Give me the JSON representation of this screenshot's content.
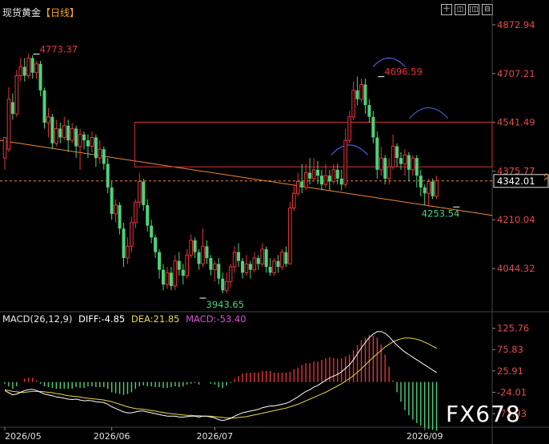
{
  "title": "现货黄金",
  "period_label": "【日线】",
  "toolbar": [
    "十",
    "◫",
    "|◫",
    "⊟"
  ],
  "watermark": "FX678",
  "colors": {
    "up": "#e8333a",
    "down": "#4fd17a",
    "diff": "#ffffff",
    "dea": "#e6d94a",
    "macd_label": "#d652d6",
    "trend": "#f0883a",
    "axis_label": "#e34a4a",
    "box": "#d8333a",
    "arc": "#4a5ad8",
    "current": "#f0883a"
  },
  "chart_data": [
    {
      "type": "candlestick",
      "y_axis_labels": [
        "4872.94",
        "4707.21",
        "4541.49",
        "4375.77",
        "4210.04",
        "4044.32"
      ],
      "ylim": [
        3900,
        4930
      ],
      "current_price": "4342.01",
      "x_axis_labels": [
        "2026/05",
        "2026/06",
        "2026/07",
        "2026/09"
      ],
      "annotations": [
        {
          "text": "4773.37",
          "price": 4773.37,
          "index": 8
        },
        {
          "text": "4696.59",
          "price": 4696.59,
          "index": 95
        },
        {
          "text": "4253.54",
          "price": 4253.54,
          "index": 114
        },
        {
          "text": "3943.65",
          "price": 3943.65,
          "index": 50
        }
      ],
      "candles": [
        [
          4420,
          4490,
          4455,
          4380
        ],
        [
          4450,
          4620,
          4660,
          4440
        ],
        [
          4610,
          4570,
          4640,
          4550
        ],
        [
          4570,
          4700,
          4720,
          4560
        ],
        [
          4700,
          4730,
          4760,
          4680
        ],
        [
          4730,
          4700,
          4760,
          4680
        ],
        [
          4700,
          4760,
          4773.37,
          4690
        ],
        [
          4760,
          4710,
          4770,
          4690
        ],
        [
          4710,
          4740,
          4750,
          4690
        ],
        [
          4740,
          4650,
          4750,
          4630
        ],
        [
          4650,
          4540,
          4660,
          4520
        ],
        [
          4540,
          4560,
          4590,
          4490
        ],
        [
          4560,
          4470,
          4570,
          4450
        ],
        [
          4470,
          4520,
          4550,
          4460
        ],
        [
          4520,
          4490,
          4540,
          4470
        ],
        [
          4490,
          4530,
          4560,
          4480
        ],
        [
          4530,
          4480,
          4550,
          4440
        ],
        [
          4480,
          4520,
          4540,
          4470
        ],
        [
          4520,
          4460,
          4530,
          4420
        ],
        [
          4460,
          4500,
          4520,
          4380
        ],
        [
          4500,
          4480,
          4510,
          4450
        ],
        [
          4480,
          4460,
          4500,
          4420
        ],
        [
          4460,
          4490,
          4510,
          4440
        ],
        [
          4490,
          4420,
          4500,
          4390
        ],
        [
          4420,
          4450,
          4480,
          4400
        ],
        [
          4450,
          4400,
          4460,
          4380
        ],
        [
          4400,
          4320,
          4420,
          4300
        ],
        [
          4320,
          4230,
          4340,
          4210
        ],
        [
          4230,
          4260,
          4280,
          4200
        ],
        [
          4260,
          4180,
          4270,
          4160
        ],
        [
          4180,
          4080,
          4200,
          4050
        ],
        [
          4080,
          4120,
          4150,
          4060
        ],
        [
          4120,
          4200,
          4220,
          4100
        ],
        [
          4200,
          4270,
          4280,
          4180
        ],
        [
          4270,
          4340,
          4370,
          4250
        ],
        [
          4340,
          4260,
          4350,
          4240
        ],
        [
          4260,
          4190,
          4280,
          4170
        ],
        [
          4190,
          4150,
          4210,
          4130
        ],
        [
          4150,
          4100,
          4160,
          4080
        ],
        [
          4100,
          4040,
          4110,
          4010
        ],
        [
          4040,
          3990,
          4060,
          3970
        ],
        [
          3990,
          4030,
          4050,
          3975
        ],
        [
          4030,
          3985,
          4050,
          3970
        ],
        [
          3985,
          4070,
          4090,
          3970
        ],
        [
          4070,
          4040,
          4100,
          4020
        ],
        [
          4040,
          4020,
          4060,
          3990
        ],
        [
          4020,
          4090,
          4110,
          4010
        ],
        [
          4090,
          4140,
          4160,
          4080
        ],
        [
          4140,
          4100,
          4150,
          4080
        ],
        [
          4100,
          4060,
          4110,
          4040
        ],
        [
          4060,
          4120,
          4180,
          4050
        ],
        [
          4120,
          4080,
          4140,
          4060
        ],
        [
          4080,
          4040,
          4090,
          4020
        ],
        [
          4040,
          4060,
          4070,
          4000
        ],
        [
          4060,
          4010,
          4080,
          3990
        ],
        [
          4010,
          3970,
          4030,
          3960
        ],
        [
          3970,
          4000,
          4030,
          3960
        ],
        [
          4000,
          4050,
          4060,
          3980
        ],
        [
          4050,
          4100,
          4120,
          4030
        ],
        [
          4100,
          4070,
          4130,
          4050
        ],
        [
          4070,
          4030,
          4080,
          4010
        ],
        [
          4030,
          4060,
          4090,
          4020
        ],
        [
          4060,
          4040,
          4070,
          4010
        ],
        [
          4040,
          4080,
          4100,
          4030
        ],
        [
          4080,
          4060,
          4090,
          4040
        ],
        [
          4060,
          4110,
          4130,
          4050
        ],
        [
          4110,
          4050,
          4120,
          4030
        ],
        [
          4050,
          4030,
          4080,
          4020
        ],
        [
          4030,
          4070,
          4080,
          4020
        ],
        [
          4070,
          4050,
          4090,
          4030
        ],
        [
          4050,
          4100,
          4110,
          4040
        ],
        [
          4100,
          4060,
          4120,
          4050
        ],
        [
          4060,
          4250,
          4270,
          4060
        ],
        [
          4250,
          4300,
          4330,
          4240
        ],
        [
          4300,
          4340,
          4370,
          4290
        ],
        [
          4340,
          4320,
          4400,
          4300
        ],
        [
          4320,
          4370,
          4400,
          4310
        ],
        [
          4370,
          4350,
          4420,
          4330
        ],
        [
          4350,
          4380,
          4420,
          4340
        ],
        [
          4380,
          4360,
          4410,
          4330
        ],
        [
          4360,
          4330,
          4380,
          4310
        ],
        [
          4330,
          4360,
          4400,
          4320
        ],
        [
          4360,
          4340,
          4380,
          4310
        ],
        [
          4340,
          4380,
          4400,
          4330
        ],
        [
          4380,
          4350,
          4400,
          4330
        ],
        [
          4350,
          4330,
          4380,
          4310
        ],
        [
          4330,
          4480,
          4520,
          4320
        ],
        [
          4480,
          4560,
          4580,
          4470
        ],
        [
          4560,
          4650,
          4680,
          4550
        ],
        [
          4650,
          4620,
          4696.59,
          4600
        ],
        [
          4620,
          4670,
          4690,
          4610
        ],
        [
          4670,
          4600,
          4690,
          4570
        ],
        [
          4600,
          4560,
          4620,
          4540
        ],
        [
          4560,
          4490,
          4580,
          4470
        ],
        [
          4490,
          4380,
          4510,
          4350
        ],
        [
          4380,
          4420,
          4460,
          4360
        ],
        [
          4420,
          4350,
          4430,
          4330
        ],
        [
          4350,
          4390,
          4420,
          4330
        ],
        [
          4390,
          4460,
          4500,
          4380
        ],
        [
          4460,
          4420,
          4470,
          4390
        ],
        [
          4420,
          4400,
          4440,
          4380
        ],
        [
          4400,
          4430,
          4450,
          4360
        ],
        [
          4430,
          4380,
          4440,
          4340
        ],
        [
          4380,
          4420,
          4430,
          4360
        ],
        [
          4420,
          4360,
          4430,
          4320
        ],
        [
          4360,
          4320,
          4380,
          4290
        ],
        [
          4320,
          4300,
          4330,
          4260
        ],
        [
          4300,
          4340,
          4350,
          4253.54
        ],
        [
          4340,
          4290,
          4350,
          4280
        ],
        [
          4290,
          4342,
          4360,
          4280
        ]
      ]
    },
    {
      "type": "macd",
      "legend": {
        "name": "MACD(26,12,9)",
        "diff": "DIFF:-4.85",
        "dea": "DEA:21.85",
        "macd": "MACD:-53.40"
      },
      "y_axis_labels": [
        "125.76",
        "75.83",
        "25.91",
        "-24.01",
        "-73.93"
      ],
      "ylim": [
        -100,
        140
      ],
      "diff": [
        -20,
        -25,
        -30,
        -28,
        -24,
        -20,
        -18,
        -17,
        -20,
        -24,
        -28,
        -30,
        -32,
        -35,
        -36,
        -38,
        -40,
        -41,
        -40,
        -42,
        -44,
        -43,
        -44,
        -46,
        -47,
        -48,
        -52,
        -58,
        -62,
        -66,
        -70,
        -72,
        -72,
        -70,
        -68,
        -68,
        -70,
        -72,
        -74,
        -76,
        -78,
        -80,
        -80,
        -80,
        -82,
        -82,
        -81,
        -80,
        -80,
        -82,
        -80,
        -80,
        -82,
        -84,
        -88,
        -90,
        -88,
        -85,
        -80,
        -76,
        -72,
        -70,
        -68,
        -66,
        -64,
        -60,
        -58,
        -56,
        -56,
        -54,
        -52,
        -50,
        -46,
        -40,
        -35,
        -28,
        -22,
        -18,
        -12,
        -8,
        -2,
        4,
        10,
        14,
        18,
        24,
        32,
        40,
        52,
        66,
        80,
        92,
        104,
        112,
        118,
        118,
        114,
        106,
        96,
        86,
        78,
        70,
        64,
        58,
        52,
        46,
        40,
        34,
        28,
        22,
        16,
        10,
        4,
        0,
        -2,
        -4.85
      ],
      "dea": [
        -18,
        -20,
        -22,
        -23,
        -24,
        -24,
        -23,
        -22,
        -22,
        -22,
        -23,
        -24,
        -25,
        -27,
        -28,
        -30,
        -32,
        -33,
        -34,
        -35,
        -37,
        -38,
        -39,
        -40,
        -41,
        -42,
        -44,
        -46,
        -49,
        -52,
        -55,
        -58,
        -60,
        -62,
        -63,
        -64,
        -65,
        -67,
        -68,
        -70,
        -71,
        -73,
        -74,
        -75,
        -76,
        -77,
        -78,
        -78,
        -79,
        -79,
        -80,
        -80,
        -80,
        -81,
        -82,
        -83,
        -84,
        -84,
        -84,
        -83,
        -82,
        -81,
        -79,
        -77,
        -75,
        -73,
        -71,
        -69,
        -67,
        -65,
        -63,
        -61,
        -58,
        -55,
        -52,
        -48,
        -44,
        -40,
        -36,
        -32,
        -28,
        -24,
        -19,
        -14,
        -9,
        -4,
        2,
        8,
        15,
        23,
        31,
        40,
        49,
        58,
        66,
        74,
        82,
        88,
        94,
        98,
        101,
        103,
        103,
        102,
        100,
        97,
        93,
        89,
        84,
        79,
        73,
        67,
        61,
        55,
        49,
        43,
        37,
        31,
        26,
        21.85
      ],
      "macd": [
        -4,
        -10,
        -16,
        -10,
        0,
        8,
        10,
        10,
        4,
        -4,
        -10,
        -12,
        -14,
        -16,
        -16,
        -16,
        -16,
        -16,
        -12,
        -14,
        -14,
        -10,
        -10,
        -12,
        -12,
        -12,
        -16,
        -24,
        -26,
        -28,
        -30,
        -28,
        -24,
        -16,
        -10,
        -8,
        -10,
        -10,
        -12,
        -12,
        -14,
        -14,
        -12,
        -10,
        -12,
        -10,
        -6,
        -4,
        -2,
        -6,
        0,
        0,
        -4,
        -6,
        -12,
        -14,
        -8,
        -2,
        8,
        14,
        20,
        22,
        22,
        22,
        22,
        26,
        26,
        26,
        22,
        22,
        22,
        22,
        24,
        30,
        34,
        40,
        44,
        44,
        48,
        48,
        52,
        56,
        58,
        56,
        54,
        56,
        60,
        64,
        74,
        86,
        98,
        104,
        110,
        108,
        104,
        88,
        64,
        36,
        4,
        -24,
        -46,
        -66,
        -78,
        -88,
        -96,
        -102,
        -106,
        -110,
        -112,
        -114,
        -114,
        -114,
        -114,
        -110,
        -102,
        -94,
        -80,
        -62,
        -53.4
      ]
    }
  ]
}
